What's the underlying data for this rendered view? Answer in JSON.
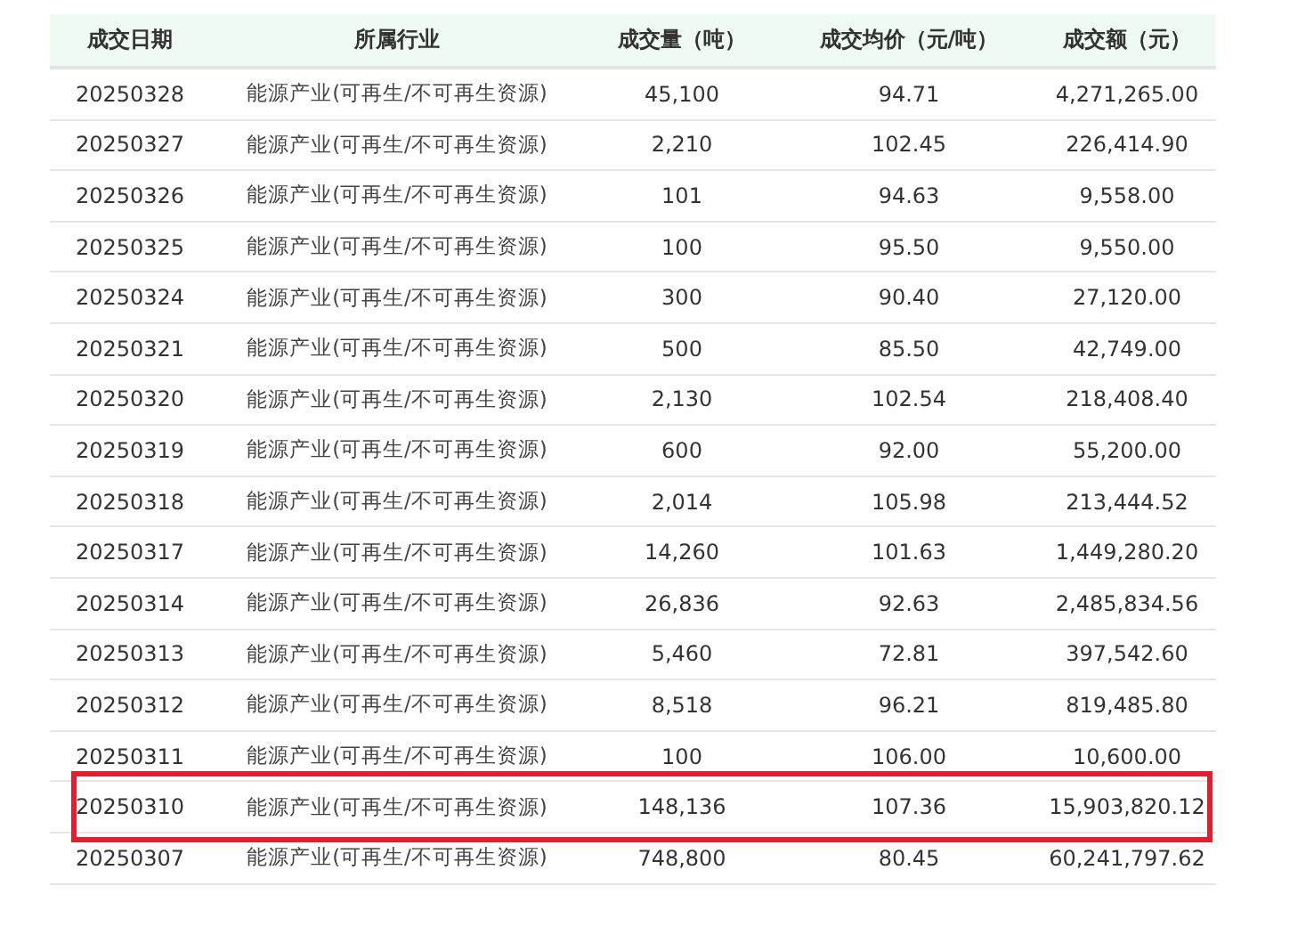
{
  "table": {
    "columns": [
      "成交日期",
      "所属行业",
      "成交量（吨）",
      "成交均价（元/吨）",
      "成交额（元）"
    ],
    "rows": [
      {
        "cells": [
          "20250328",
          "能源产业(可再生/不可再生资源)",
          "45,100",
          "94.71",
          "4,271,265.00"
        ],
        "highlighted": false
      },
      {
        "cells": [
          "20250327",
          "能源产业(可再生/不可再生资源)",
          "2,210",
          "102.45",
          "226,414.90"
        ],
        "highlighted": false
      },
      {
        "cells": [
          "20250326",
          "能源产业(可再生/不可再生资源)",
          "101",
          "94.63",
          "9,558.00"
        ],
        "highlighted": false
      },
      {
        "cells": [
          "20250325",
          "能源产业(可再生/不可再生资源)",
          "100",
          "95.50",
          "9,550.00"
        ],
        "highlighted": false
      },
      {
        "cells": [
          "20250324",
          "能源产业(可再生/不可再生资源)",
          "300",
          "90.40",
          "27,120.00"
        ],
        "highlighted": false
      },
      {
        "cells": [
          "20250321",
          "能源产业(可再生/不可再生资源)",
          "500",
          "85.50",
          "42,749.00"
        ],
        "highlighted": false
      },
      {
        "cells": [
          "20250320",
          "能源产业(可再生/不可再生资源)",
          "2,130",
          "102.54",
          "218,408.40"
        ],
        "highlighted": false
      },
      {
        "cells": [
          "20250319",
          "能源产业(可再生/不可再生资源)",
          "600",
          "92.00",
          "55,200.00"
        ],
        "highlighted": false
      },
      {
        "cells": [
          "20250318",
          "能源产业(可再生/不可再生资源)",
          "2,014",
          "105.98",
          "213,444.52"
        ],
        "highlighted": false
      },
      {
        "cells": [
          "20250317",
          "能源产业(可再生/不可再生资源)",
          "14,260",
          "101.63",
          "1,449,280.20"
        ],
        "highlighted": false
      },
      {
        "cells": [
          "20250314",
          "能源产业(可再生/不可再生资源)",
          "26,836",
          "92.63",
          "2,485,834.56"
        ],
        "highlighted": false
      },
      {
        "cells": [
          "20250313",
          "能源产业(可再生/不可再生资源)",
          "5,460",
          "72.81",
          "397,542.60"
        ],
        "highlighted": false
      },
      {
        "cells": [
          "20250312",
          "能源产业(可再生/不可再生资源)",
          "8,518",
          "96.21",
          "819,485.80"
        ],
        "highlighted": false
      },
      {
        "cells": [
          "20250311",
          "能源产业(可再生/不可再生资源)",
          "100",
          "106.00",
          "10,600.00"
        ],
        "highlighted": false
      },
      {
        "cells": [
          "20250310",
          "能源产业(可再生/不可再生资源)",
          "148,136",
          "107.36",
          "15,903,820.12"
        ],
        "highlighted": true
      },
      {
        "cells": [
          "20250307",
          "能源产业(可再生/不可再生资源)",
          "748,800",
          "80.45",
          "60,241,797.62"
        ],
        "highlighted": false
      }
    ]
  }
}
